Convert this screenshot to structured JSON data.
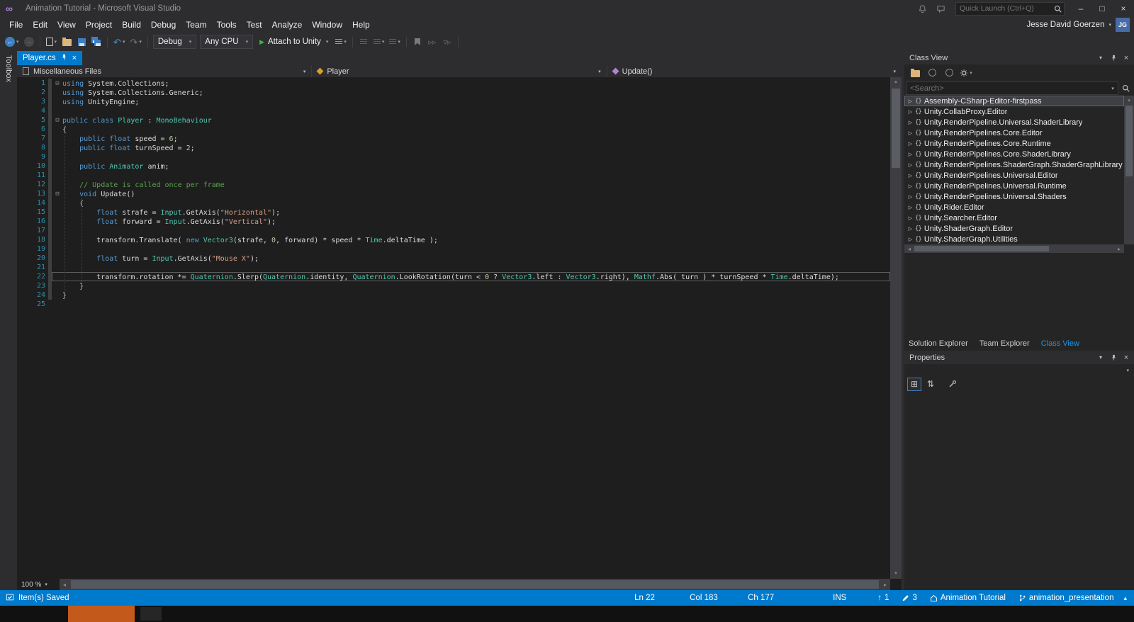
{
  "colors": {
    "accent": "#007acc",
    "statusbar_bg": "#007acc",
    "chrome_bg": "#2d2d30",
    "editor_bg": "#1e1e1e",
    "panel_bg": "#252526",
    "line_number": "#2b91af",
    "keyword": "#569cd6",
    "type": "#4ec9b0",
    "string": "#d69d85",
    "comment": "#57a64a",
    "number": "#b5cea8",
    "active_tab": "#007acc",
    "taskbar_attention": "#c35a1c"
  },
  "titlebar": {
    "title": "Animation Tutorial - Microsoft Visual Studio",
    "quick_launch_placeholder": "Quick Launch (Ctrl+Q)"
  },
  "menubar": {
    "items": [
      "File",
      "Edit",
      "View",
      "Project",
      "Build",
      "Debug",
      "Team",
      "Tools",
      "Test",
      "Analyze",
      "Window",
      "Help"
    ],
    "user_name": "Jesse David Goerzen",
    "avatar_initials": "JG"
  },
  "toolbar": {
    "debug_config": "Debug",
    "platform": "Any CPU",
    "attach_label": "Attach to Unity"
  },
  "toolbox": {
    "label": "Toolbox"
  },
  "editor": {
    "tab_title": "Player.cs",
    "nav": {
      "scope": "Miscellaneous Files",
      "type": "Player",
      "member": "Update()"
    },
    "zoom": "100 %",
    "current_line": 22,
    "lines": [
      {
        "n": 1,
        "fold": true,
        "tokens": [
          [
            "k",
            "using"
          ],
          [
            "p",
            " System.Collections;"
          ]
        ]
      },
      {
        "n": 2,
        "tokens": [
          [
            "k",
            "using"
          ],
          [
            "p",
            " System.Collections.Generic;"
          ]
        ]
      },
      {
        "n": 3,
        "tokens": [
          [
            "k",
            "using"
          ],
          [
            "p",
            " UnityEngine;"
          ]
        ]
      },
      {
        "n": 4,
        "tokens": []
      },
      {
        "n": 5,
        "fold": true,
        "tokens": [
          [
            "k",
            "public"
          ],
          [
            "p",
            " "
          ],
          [
            "k",
            "class"
          ],
          [
            "p",
            " "
          ],
          [
            "t",
            "Player"
          ],
          [
            "p",
            " : "
          ],
          [
            "t",
            "MonoBehaviour"
          ]
        ]
      },
      {
        "n": 6,
        "tokens": [
          [
            "p",
            "{"
          ]
        ]
      },
      {
        "n": 7,
        "tokens": [
          [
            "p",
            "    "
          ],
          [
            "k",
            "public"
          ],
          [
            "p",
            " "
          ],
          [
            "k",
            "float"
          ],
          [
            "p",
            " speed = "
          ],
          [
            "n",
            "6"
          ],
          [
            "p",
            ";"
          ]
        ]
      },
      {
        "n": 8,
        "tokens": [
          [
            "p",
            "    "
          ],
          [
            "k",
            "public"
          ],
          [
            "p",
            " "
          ],
          [
            "k",
            "float"
          ],
          [
            "p",
            " turnSpeed = "
          ],
          [
            "n",
            "2"
          ],
          [
            "p",
            ";"
          ]
        ]
      },
      {
        "n": 9,
        "tokens": []
      },
      {
        "n": 10,
        "tokens": [
          [
            "p",
            "    "
          ],
          [
            "k",
            "public"
          ],
          [
            "p",
            " "
          ],
          [
            "t",
            "Animator"
          ],
          [
            "p",
            " anim;"
          ]
        ]
      },
      {
        "n": 11,
        "tokens": []
      },
      {
        "n": 12,
        "tokens": [
          [
            "p",
            "    "
          ],
          [
            "c",
            "// Update is called once per frame"
          ]
        ]
      },
      {
        "n": 13,
        "fold": true,
        "tokens": [
          [
            "p",
            "    "
          ],
          [
            "k",
            "void"
          ],
          [
            "p",
            " Update()"
          ]
        ]
      },
      {
        "n": 14,
        "tokens": [
          [
            "p",
            "    {"
          ]
        ]
      },
      {
        "n": 15,
        "tokens": [
          [
            "p",
            "        "
          ],
          [
            "k",
            "float"
          ],
          [
            "p",
            " strafe = "
          ],
          [
            "t",
            "Input"
          ],
          [
            "p",
            ".GetAxis("
          ],
          [
            "s",
            "\"Horizontal\""
          ],
          [
            "p",
            ");"
          ]
        ]
      },
      {
        "n": 16,
        "tokens": [
          [
            "p",
            "        "
          ],
          [
            "k",
            "float"
          ],
          [
            "p",
            " forward = "
          ],
          [
            "t",
            "Input"
          ],
          [
            "p",
            ".GetAxis("
          ],
          [
            "s",
            "\"Vertical\""
          ],
          [
            "p",
            ");"
          ]
        ]
      },
      {
        "n": 17,
        "tokens": []
      },
      {
        "n": 18,
        "tokens": [
          [
            "p",
            "        transform.Translate( "
          ],
          [
            "k",
            "new"
          ],
          [
            "p",
            " "
          ],
          [
            "t",
            "Vector3"
          ],
          [
            "p",
            "(strafe, "
          ],
          [
            "n",
            "0"
          ],
          [
            "p",
            ", forward) * speed * "
          ],
          [
            "t",
            "Time"
          ],
          [
            "p",
            ".deltaTime );"
          ]
        ]
      },
      {
        "n": 19,
        "tokens": []
      },
      {
        "n": 20,
        "tokens": [
          [
            "p",
            "        "
          ],
          [
            "k",
            "float"
          ],
          [
            "p",
            " turn = "
          ],
          [
            "t",
            "Input"
          ],
          [
            "p",
            ".GetAxis("
          ],
          [
            "s",
            "\"Mouse X\""
          ],
          [
            "p",
            ");"
          ]
        ]
      },
      {
        "n": 21,
        "tokens": []
      },
      {
        "n": 22,
        "tokens": [
          [
            "p",
            "        transform.rotation *= "
          ],
          [
            "t",
            "Quaternion"
          ],
          [
            "p",
            ".Slerp("
          ],
          [
            "t",
            "Quaternion"
          ],
          [
            "p",
            ".identity, "
          ],
          [
            "t",
            "Quaternion"
          ],
          [
            "p",
            ".LookRotation(turn < "
          ],
          [
            "n",
            "0"
          ],
          [
            "p",
            " ? "
          ],
          [
            "t",
            "Vector3"
          ],
          [
            "p",
            ".left : "
          ],
          [
            "t",
            "Vector3"
          ],
          [
            "p",
            ".right), "
          ],
          [
            "t",
            "Mathf"
          ],
          [
            "p",
            ".Abs( turn ) * turnSpeed * "
          ],
          [
            "t",
            "Time"
          ],
          [
            "p",
            ".deltaTime);"
          ]
        ]
      },
      {
        "n": 23,
        "tokens": [
          [
            "p",
            "    }"
          ]
        ]
      },
      {
        "n": 24,
        "tokens": [
          [
            "p",
            "}"
          ]
        ]
      },
      {
        "n": 25,
        "tokens": []
      }
    ]
  },
  "class_view": {
    "title": "Class View",
    "search_placeholder": "<Search>",
    "selected_index": 0,
    "items": [
      "Assembly-CSharp-Editor-firstpass",
      "Unity.CollabProxy.Editor",
      "Unity.RenderPipeline.Universal.ShaderLibrary",
      "Unity.RenderPipelines.Core.Editor",
      "Unity.RenderPipelines.Core.Runtime",
      "Unity.RenderPipelines.Core.ShaderLibrary",
      "Unity.RenderPipelines.ShaderGraph.ShaderGraphLibrary",
      "Unity.RenderPipelines.Universal.Editor",
      "Unity.RenderPipelines.Universal.Runtime",
      "Unity.RenderPipelines.Universal.Shaders",
      "Unity.Rider.Editor",
      "Unity.Searcher.Editor",
      "Unity.ShaderGraph.Editor",
      "Unity.ShaderGraph.Utilities"
    ]
  },
  "panel_tabs": [
    {
      "label": "Solution Explorer",
      "active": false
    },
    {
      "label": "Team Explorer",
      "active": false
    },
    {
      "label": "Class View",
      "active": true
    }
  ],
  "properties": {
    "title": "Properties"
  },
  "status_bar": {
    "message": "Item(s) Saved",
    "line": "Ln 22",
    "column": "Col 183",
    "character": "Ch 177",
    "mode": "INS",
    "unpushed_count": "1",
    "changes_count": "3",
    "repo": "Animation Tutorial",
    "branch": "animation_presentation"
  }
}
